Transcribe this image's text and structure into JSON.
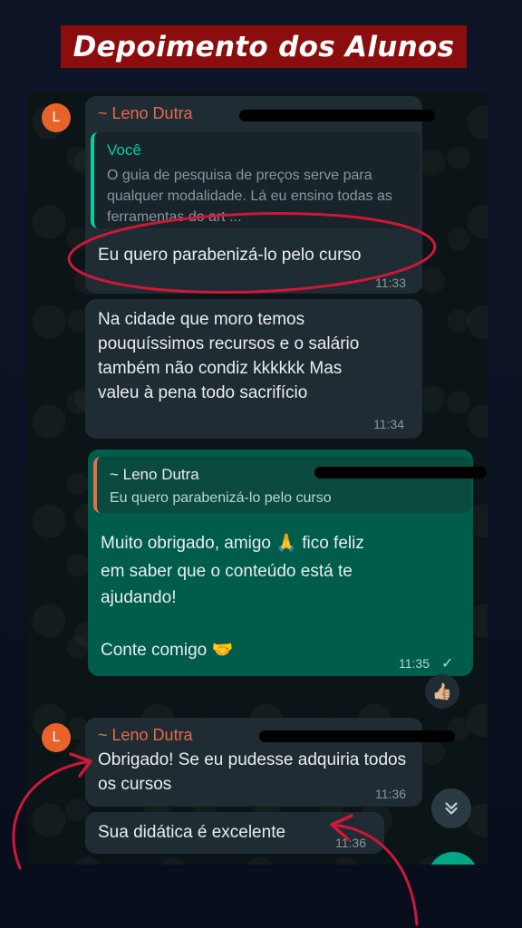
{
  "header": {
    "title": "Depoimento dos Alunos"
  },
  "chat": {
    "msg1": {
      "avatar_letter": "L",
      "sender": "~ Leno Dutra",
      "quote_name": "Você",
      "quote_text": "O guia de pesquisa de preços serve para qualquer modalidade. Lá eu ensino todas as ferramentas do art ...",
      "text": "Eu quero parabenizá-lo pelo curso",
      "time": "11:33"
    },
    "msg2": {
      "text": "Na cidade que moro temos pouquíssimos recursos e o salário também não condiz kkkkkk Mas valeu à pena todo sacrifício",
      "time": "11:34"
    },
    "msg3": {
      "quote_name": "~ Leno Dutra",
      "quote_text": "Eu quero parabenizá-lo pelo curso",
      "line1": "Muito obrigado, amigo 🙏 fico feliz",
      "line2": "em saber que o conteúdo está te",
      "line3": "ajudando!",
      "line4": "Conte comigo 🤝",
      "time": "11:35",
      "status": "✓",
      "reaction": "👍🏼"
    },
    "msg4": {
      "avatar_letter": "L",
      "sender": "~ Leno Dutra",
      "text": "Obrigado! Se eu pudesse adquiria todos os cursos",
      "time": "11:36"
    },
    "msg5": {
      "text": "Sua didática é excelente",
      "time": "11:36"
    },
    "scroll_button_icon": "double-chevron-down",
    "colors": {
      "title_bg": "#8b0d0d",
      "annotation": "#d0173a",
      "outgoing": "#005c4b",
      "incoming": "#1f2c33"
    }
  }
}
